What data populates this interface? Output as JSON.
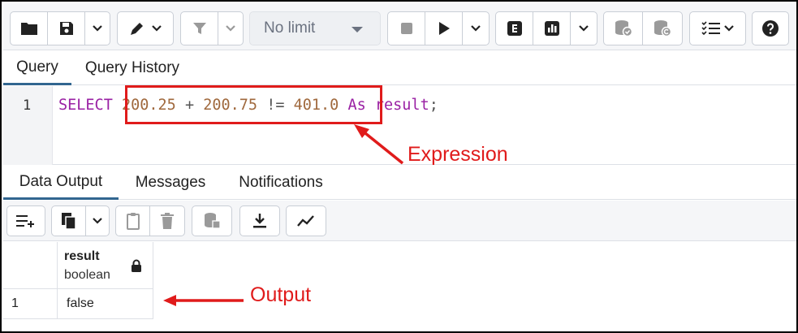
{
  "toolbar": {
    "limit_label": "No limit",
    "limit_caret_icon": "caret-down-icon",
    "buttons": [
      "folder-open-icon",
      "save-icon",
      "chevron-down-icon",
      "pencil-icon",
      "filter-icon",
      "stop-icon",
      "play-icon",
      "explain-icon",
      "explain-analyze-icon",
      "commit-icon",
      "rollback-icon",
      "macros-icon",
      "help-icon"
    ]
  },
  "query_tabs": [
    "Query",
    "Query History"
  ],
  "editor": {
    "line_number": "1",
    "tokens": {
      "select": "SELECT",
      "n1": "200.25",
      "plus": "+",
      "n2": "200.75",
      "neq": "!=",
      "n3": "401.0",
      "as": "As",
      "alias": "result",
      "semi": ";"
    }
  },
  "annotations": {
    "expression_label": "Expression",
    "output_label": "Output",
    "color": "#e01b1b"
  },
  "output_tabs": [
    "Data Output",
    "Messages",
    "Notifications"
  ],
  "result_grid": {
    "columns": [
      {
        "name": "result",
        "type": "boolean",
        "lock_icon": "lock-icon"
      }
    ],
    "rows": [
      {
        "row_number": "1",
        "values": [
          "false"
        ]
      }
    ]
  },
  "colors": {
    "accent": "#326690",
    "keyword": "#9a21a4",
    "number": "#a0693d"
  }
}
